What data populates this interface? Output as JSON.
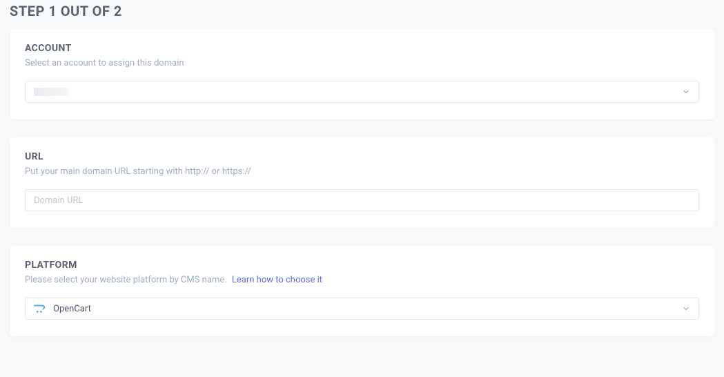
{
  "page": {
    "title": "STEP 1 OUT OF 2"
  },
  "account": {
    "heading": "ACCOUNT",
    "subtitle": "Select an account to assign this domain",
    "selected": ""
  },
  "url": {
    "heading": "URL",
    "subtitle": "Put your main domain URL starting with http:// or https://",
    "placeholder": "Domain URL",
    "value": ""
  },
  "platform": {
    "heading": "PLATFORM",
    "subtitle_text": "Please select your website platform by CMS name.",
    "learn_link": "Learn how to choose it",
    "selected": "OpenCart",
    "icon": "opencart-icon"
  }
}
